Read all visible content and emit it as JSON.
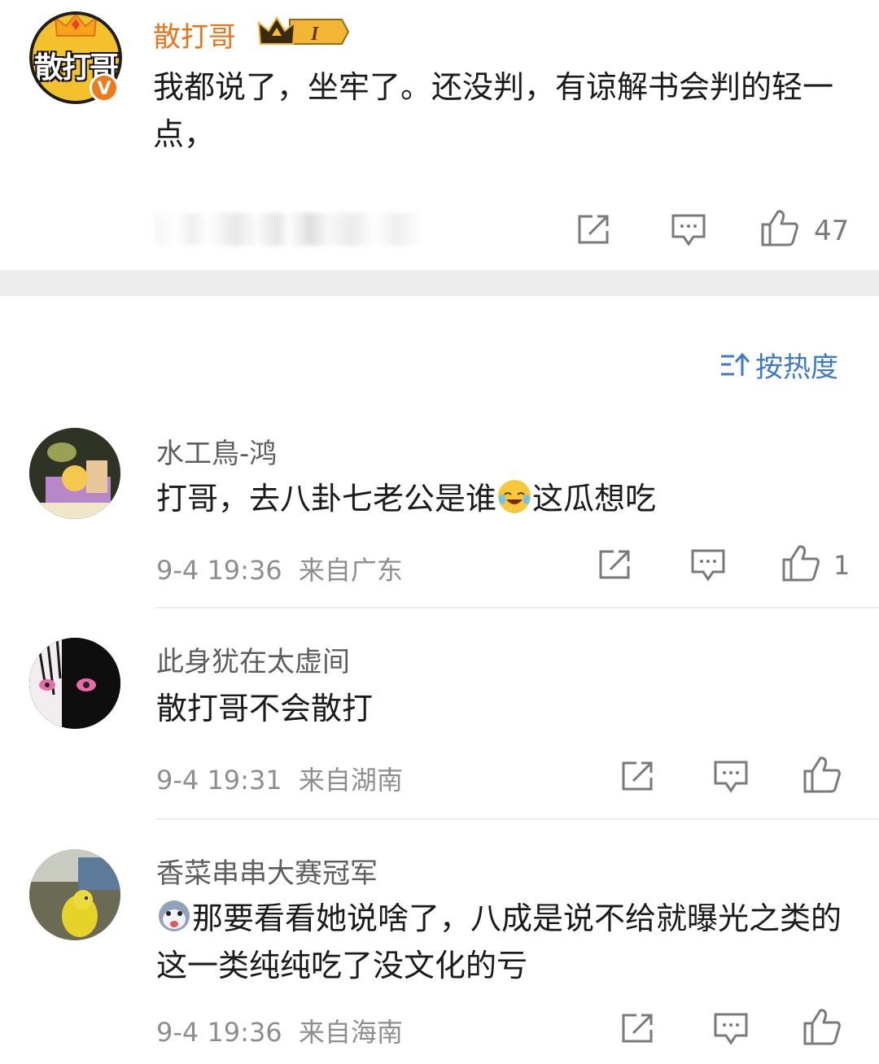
{
  "post": {
    "author": "散打哥",
    "avatar_text": "散打哥",
    "badge_level": "I",
    "verified_mark": "V",
    "text": "我都说了，坐牢了。还没判，有谅解书会判的轻一点，",
    "like_count": "47"
  },
  "sort": {
    "label": "按热度"
  },
  "comments": [
    {
      "name": "水工鳥-鸿",
      "text_before": "打哥，去八卦七老公是谁",
      "text_after": "这瓜想吃",
      "time": "9-4 19:36",
      "location": "来自广东",
      "likes": "1"
    },
    {
      "name": "此身犹在太虚间",
      "text": "散打哥不会散打",
      "time": "9-4 19:31",
      "location": "来自湖南",
      "likes": ""
    },
    {
      "name": "香菜串串大赛冠军",
      "text": "那要看看她说啥了，八成是说不给就曝光之类的这一类纯纯吃了没文化的亏",
      "time": "9-4 19:36",
      "location": "来自海南",
      "likes": ""
    }
  ],
  "colors": {
    "username_orange": "#e8741c",
    "link_blue": "#3f7bc4",
    "meta_gray": "#8e8e8e",
    "band_gray": "#ececec"
  },
  "icons": [
    "share-icon",
    "comment-icon",
    "like-icon",
    "crown-icon",
    "verified-icon",
    "sort-icon",
    "laugh-cry-emoji",
    "dog-emoji"
  ]
}
